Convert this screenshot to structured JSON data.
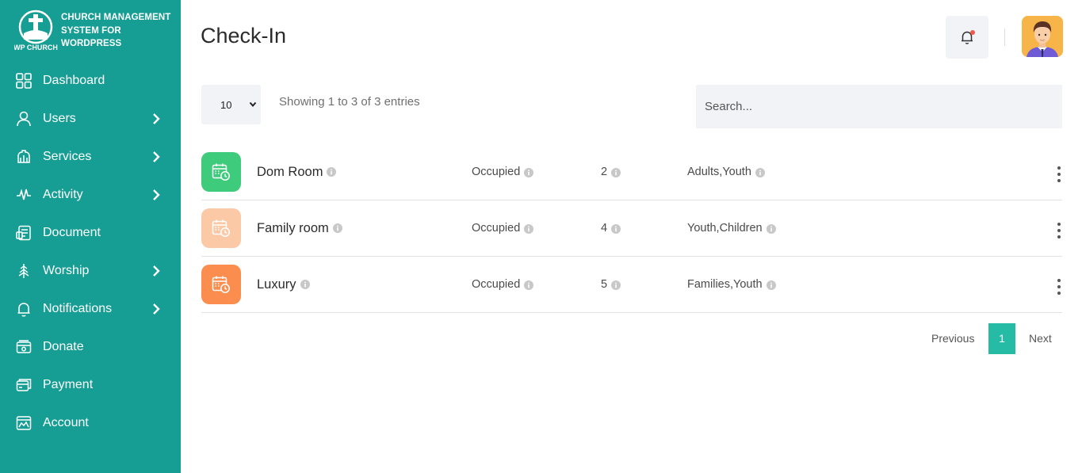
{
  "brand": {
    "logo_text": "WP CHURCH",
    "line1": "CHURCH MANAGEMENT",
    "line2": "SYSTEM FOR",
    "line3": "WORDPRESS"
  },
  "sidebar": {
    "items": [
      {
        "label": "Dashboard",
        "icon": "dashboard-grid-icon",
        "has_submenu": false
      },
      {
        "label": "Users",
        "icon": "user-icon",
        "has_submenu": true
      },
      {
        "label": "Services",
        "icon": "services-icon",
        "has_submenu": true
      },
      {
        "label": "Activity",
        "icon": "activity-pulse-icon",
        "has_submenu": true
      },
      {
        "label": "Document",
        "icon": "document-icon",
        "has_submenu": false
      },
      {
        "label": "Worship",
        "icon": "worship-icon",
        "has_submenu": true
      },
      {
        "label": "Notifications",
        "icon": "bell-icon",
        "has_submenu": true
      },
      {
        "label": "Donate",
        "icon": "donate-icon",
        "has_submenu": false
      },
      {
        "label": "Payment",
        "icon": "payment-card-icon",
        "has_submenu": false
      },
      {
        "label": "Account",
        "icon": "account-icon",
        "has_submenu": false
      }
    ]
  },
  "header": {
    "title": "Check-In"
  },
  "controls": {
    "page_length": "10",
    "info": "Showing 1 to 3 of 3 entries",
    "search_placeholder": "Search..."
  },
  "rows": [
    {
      "name": "Dom Room",
      "status": "Occupied",
      "count": "2",
      "groups": "Adults,Youth",
      "icon_color": "#3fcb7c"
    },
    {
      "name": "Family room",
      "status": "Occupied",
      "count": "4",
      "groups": "Youth,Children",
      "icon_color": "#fbc9a6"
    },
    {
      "name": "Luxury",
      "status": "Occupied",
      "count": "5",
      "groups": "Families,Youth",
      "icon_color": "#fb8e4f"
    }
  ],
  "pagination": {
    "previous": "Previous",
    "current": "1",
    "next": "Next"
  },
  "colors": {
    "sidebar": "#169e94",
    "accent": "#26bba4",
    "notification_dot": "#f0584a"
  }
}
